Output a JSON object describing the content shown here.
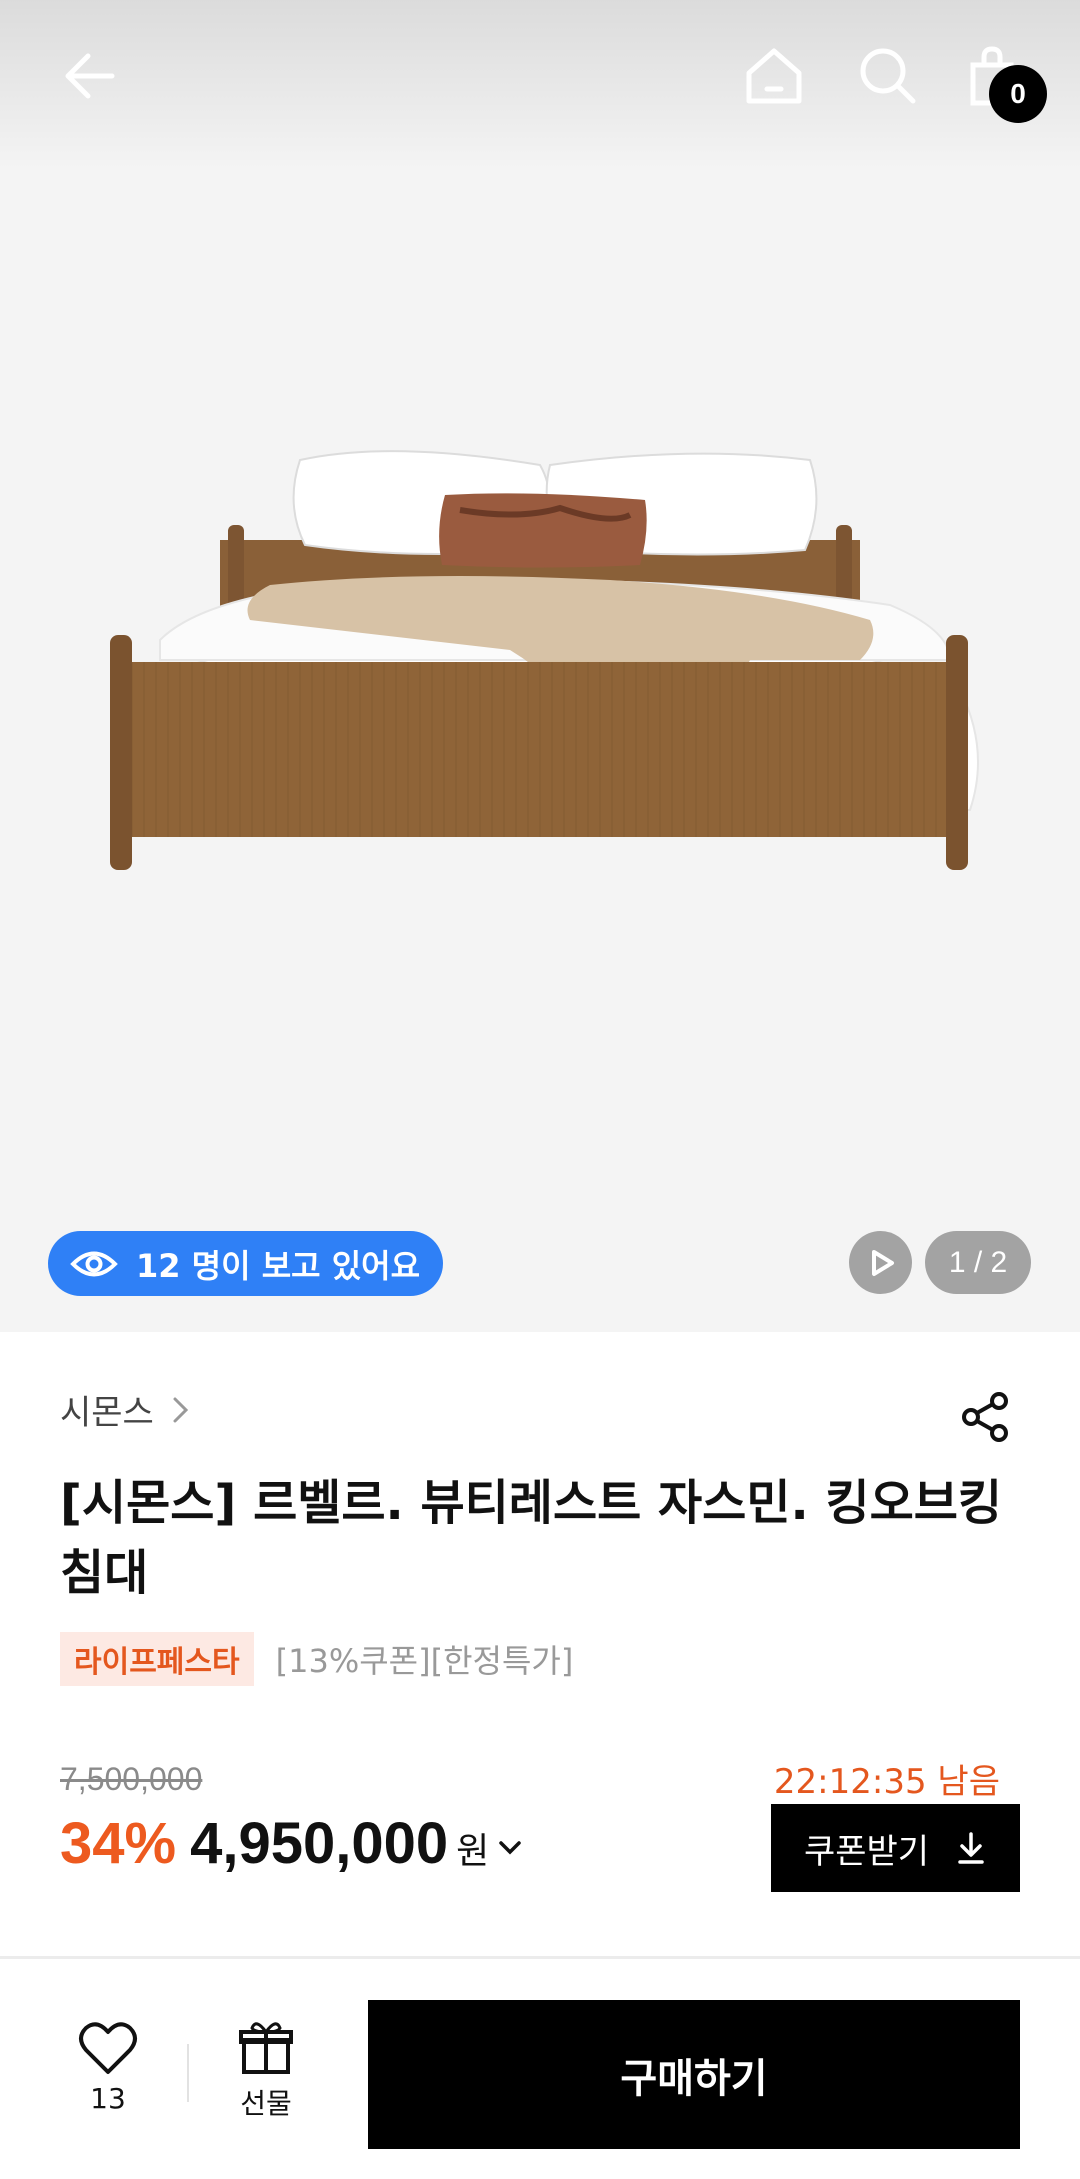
{
  "header": {
    "back_icon": "back-arrow-icon",
    "home_icon": "home-icon",
    "search_icon": "search-icon",
    "cart_icon": "shopping-bag-icon",
    "cart_count": "0"
  },
  "gallery": {
    "viewers_text": "12 명이 보고 있어요",
    "page_indicator": "1 / 2",
    "colors": {
      "viewers_pill": "#2f80f6",
      "indicator_bg": "#a3a3a3"
    }
  },
  "product": {
    "brand": "시몬스",
    "title": "[시몬스] 르벨르. 뷰티레스트 자스민. 킹오브킹 침대",
    "event_badge": "라이프페스타",
    "tags": "[13%쿠폰][한정특가]",
    "original_price": "7,500,000",
    "discount": "34%",
    "price": "4,950,000",
    "currency": "원",
    "countdown": "22:12:35 남음",
    "coupon_button": "쿠폰받기",
    "colors": {
      "accent": "#ed5a1f",
      "badge_bg": "#fde9e3"
    }
  },
  "bottom_bar": {
    "like_count": "13",
    "gift_label": "선물",
    "buy_label": "구매하기"
  }
}
